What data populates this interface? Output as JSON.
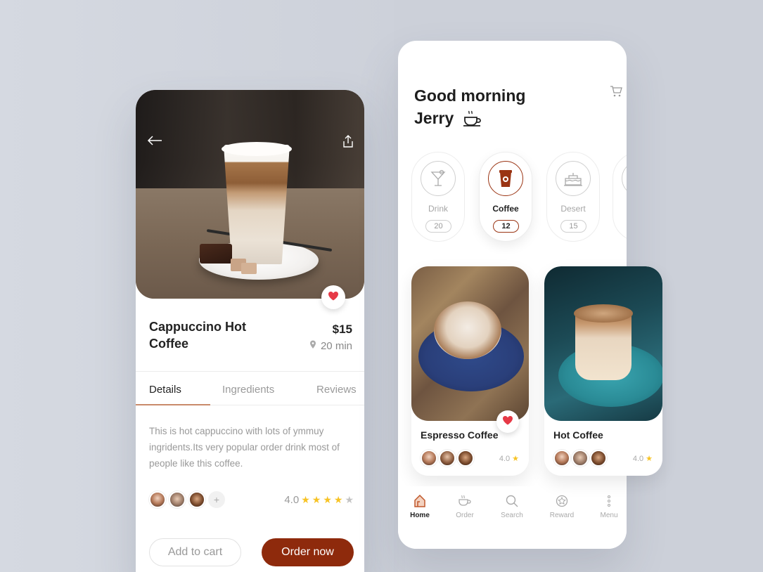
{
  "colors": {
    "accent": "#8e2a0c",
    "star": "#f7c325",
    "heart": "#e63946"
  },
  "detail": {
    "title": "Cappuccino Hot Coffee",
    "price": "$15",
    "time": "20 min",
    "tabs": [
      "Details",
      "Ingredients",
      "Reviews"
    ],
    "description": "This is hot cappuccino with lots of ymmuy ingridents.Its very popular  order drink most of people like this coffee.",
    "rating": "4.0",
    "stars": 4,
    "plus": "+",
    "add_to_cart": "Add to cart",
    "order_now": "Order now"
  },
  "home": {
    "greeting_line1": "Good morning",
    "greeting_line2": "Jerry",
    "categories": [
      {
        "label": "Drink",
        "count": "20",
        "icon": "cocktail-icon"
      },
      {
        "label": "Coffee",
        "count": "12",
        "icon": "coffee-cup-icon"
      },
      {
        "label": "Desert",
        "count": "15",
        "icon": "cake-icon"
      }
    ],
    "cards": [
      {
        "title": "Espresso Coffee",
        "rating": "4.0"
      },
      {
        "title": "Hot Coffee",
        "rating": "4.0"
      }
    ],
    "nav": [
      "Home",
      "Order",
      "Search",
      "Reward",
      "Menu"
    ]
  }
}
